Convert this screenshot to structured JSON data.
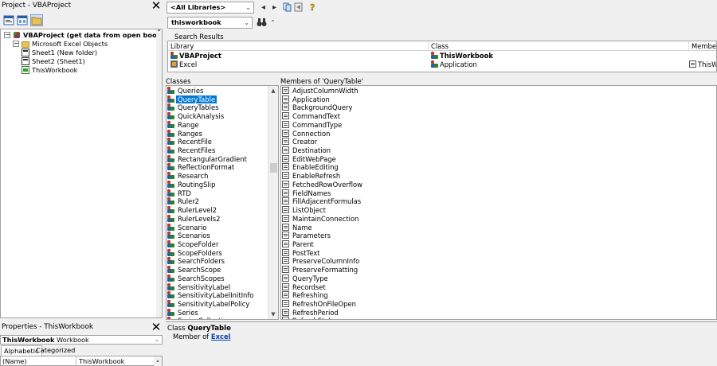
{
  "project": {
    "title": "Project - VBAProject",
    "tree": [
      {
        "label": "VBAProject (get data from open books.xlsx)",
        "icon": "vba-project-icon",
        "indent": 0,
        "bold": true,
        "expander": "−"
      },
      {
        "label": "Microsoft Excel Objects",
        "icon": "folder-icon",
        "indent": 1,
        "bold": false,
        "expander": "−"
      },
      {
        "label": "Sheet1 (New folder)",
        "icon": "sheet-icon",
        "indent": 2,
        "bold": false,
        "expander": ""
      },
      {
        "label": "Sheet2 (Sheet1)",
        "icon": "sheet-icon",
        "indent": 2,
        "bold": false,
        "expander": ""
      },
      {
        "label": "ThisWorkbook",
        "icon": "workbook-icon",
        "indent": 2,
        "bold": false,
        "expander": ""
      }
    ]
  },
  "properties": {
    "title": "Properties - ThisWorkbook",
    "object_name": "ThisWorkbook",
    "object_type": "Workbook",
    "tabs": [
      "Alphabetic",
      "Categorized"
    ],
    "row_name": "(Name)",
    "row_value": "ThisWorkbook"
  },
  "browser": {
    "library_combo": "<All Libraries>",
    "search_combo": "thisworkbook",
    "search_results_label": "Search Results",
    "columns": [
      "Library",
      "Class",
      "Member"
    ],
    "results": [
      {
        "library": "VBAProject",
        "class": "ThisWorkbook",
        "member": "",
        "bold": true
      },
      {
        "library": "Excel",
        "class": "Application",
        "member": "ThisWorkbook",
        "bold": false
      }
    ],
    "classes_label": "Classes",
    "members_label": "Members of 'QueryTable'",
    "classes": [
      "Queries",
      "QueryTable",
      "QueryTables",
      "QuickAnalysis",
      "Range",
      "Ranges",
      "RecentFile",
      "RecentFiles",
      "RectangularGradient",
      "ReflectionFormat",
      "Research",
      "RoutingSlip",
      "RTD",
      "Ruler2",
      "RulerLevel2",
      "RulerLevels2",
      "Scenario",
      "Scenarios",
      "ScopeFolder",
      "ScopeFolders",
      "SearchFolders",
      "SearchScope",
      "SearchScopes",
      "SensitivityLabel",
      "SensitivityLabelInitInfo",
      "SensitivityLabelPolicy",
      "Series",
      "SeriesCollection"
    ],
    "selected_class": "QueryTable",
    "members": [
      "AdjustColumnWidth",
      "Application",
      "BackgroundQuery",
      "CommandText",
      "CommandType",
      "Connection",
      "Creator",
      "Destination",
      "EditWebPage",
      "EnableEditing",
      "EnableRefresh",
      "FetchedRowOverflow",
      "FieldNames",
      "FillAdjacentFormulas",
      "ListObject",
      "MaintainConnection",
      "Name",
      "Parameters",
      "Parent",
      "PostText",
      "PreserveColumnInfo",
      "PreserveFormatting",
      "QueryType",
      "Recordset",
      "Refreshing",
      "RefreshOnFileOpen",
      "RefreshPeriod",
      "RefreshStyle"
    ],
    "details_prefix": "Class",
    "details_name": "QueryTable",
    "details_member_of": "Member of",
    "details_library": "Excel"
  }
}
